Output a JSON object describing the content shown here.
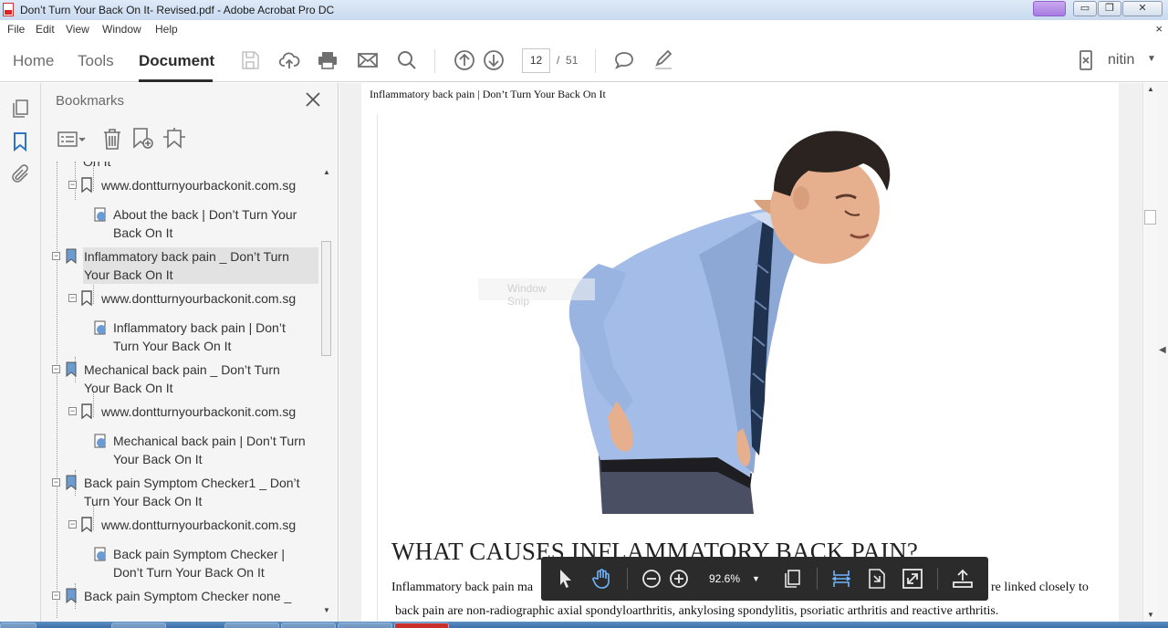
{
  "window": {
    "title": "Don’t Turn Your Back On It- Revised.pdf - Adobe Acrobat Pro DC",
    "close_glyph": "✕",
    "min_glyph": "▭",
    "max_glyph": "❐"
  },
  "menu": {
    "items": [
      "File",
      "Edit",
      "View",
      "Window",
      "Help"
    ],
    "close_doc": "×"
  },
  "toolbar": {
    "tabs": [
      "Home",
      "Tools",
      "Document"
    ],
    "active_tab": "Document",
    "current_page": "12",
    "page_separator": "/",
    "total_pages": "51",
    "user": "nitin",
    "icons": [
      "save-icon",
      "upload-cloud-icon",
      "print-icon",
      "email-icon",
      "search-icon",
      "previous-page-icon",
      "next-page-icon",
      "comment-icon",
      "sign-pen-icon",
      "mobile-link-icon"
    ]
  },
  "bookmarks": {
    "title": "Bookmarks",
    "items": [
      {
        "lines": [
          "On It"
        ]
      },
      {
        "lines": [
          "www.dontturnyourbackonit.com.sg"
        ]
      },
      {
        "lines": [
          "About the back | Don’t Turn Your",
          "Back On It"
        ]
      },
      {
        "lines": [
          "Inflammatory back pain _ Don’t Turn",
          "Your Back On It"
        ]
      },
      {
        "lines": [
          "www.dontturnyourbackonit.com.sg"
        ]
      },
      {
        "lines": [
          "Inflammatory back pain | Don’t",
          "Turn Your Back On It"
        ]
      },
      {
        "lines": [
          "Mechanical back pain _ Don’t Turn",
          "Your Back On It"
        ]
      },
      {
        "lines": [
          "www.dontturnyourbackonit.com.sg"
        ]
      },
      {
        "lines": [
          "Mechanical back pain | Don’t Turn",
          "Your Back On It"
        ]
      },
      {
        "lines": [
          "Back pain Symptom Checker1 _ Don’t",
          "Turn Your Back On It"
        ]
      },
      {
        "lines": [
          "www.dontturnyourbackonit.com.sg"
        ]
      },
      {
        "lines": [
          "Back pain Symptom Checker |",
          "Don’t Turn Your Back On It"
        ]
      },
      {
        "lines": [
          "Back pain Symptom Checker none _"
        ]
      }
    ],
    "selected_index": 3
  },
  "document": {
    "running_header": "Inflammatory back pain | Don’t Turn Your Back On It",
    "heading": "WHAT CAUSES INFLAMMATORY BACK PAIN?",
    "body_line1_left": "Inflammatory back pain ma",
    "body_line1_right": "re linked closely to",
    "body_line2": "back pain are non-radiographic axial spondyloarthritis, ankylosing spondylitis, psoriatic arthritis and reactive arthritis.",
    "ghost_label": "Window Snip"
  },
  "float_toolbar": {
    "zoom": "92.6%",
    "icons": [
      "select-arrow-icon",
      "hand-tool-icon",
      "zoom-out-icon",
      "zoom-in-icon",
      "page-display-icon",
      "fit-width-icon",
      "fit-page-icon",
      "full-screen-icon",
      "share-upload-icon"
    ]
  },
  "colors": {
    "shirt": "#9fb9e6",
    "tie": "#1f3350",
    "trousers": "#4a4f63",
    "skin": "#e6b08e",
    "hair": "#2a2320"
  }
}
